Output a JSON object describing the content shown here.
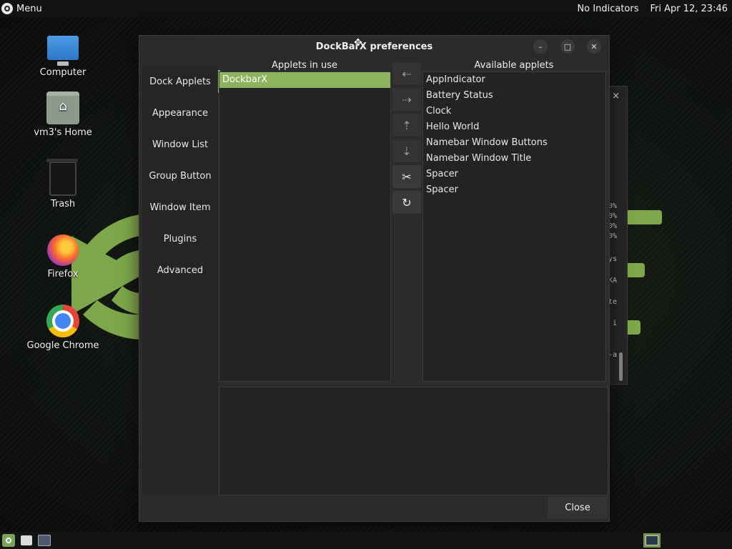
{
  "top_panel": {
    "menu_label": "Menu",
    "indicators": "No Indicators",
    "clock": "Fri Apr 12, 23:46"
  },
  "desktop_icons": [
    {
      "label": "Computer",
      "icon": "computer-icon"
    },
    {
      "label": "vm3's Home",
      "icon": "home-folder-icon"
    },
    {
      "label": "Trash",
      "icon": "trash-icon"
    },
    {
      "label": "Firefox",
      "icon": "firefox-icon"
    },
    {
      "label": "Google Chrome",
      "icon": "chrome-icon"
    }
  ],
  "dialog": {
    "title": "DockBarX preferences",
    "sidebar": [
      "Dock Applets",
      "Appearance",
      "Window List",
      "Group Button",
      "Window Item",
      "Plugins",
      "Advanced"
    ],
    "active_tab": "Dock Applets",
    "applets_in_use_header": "Applets in use",
    "applets_in_use": [
      "DockbarX"
    ],
    "available_header": "Available applets",
    "available_applets": [
      "AppIndicator",
      "Battery Status",
      "Clock",
      "Hello World",
      "Namebar Window Buttons",
      "Namebar Window Title",
      "Spacer",
      "Spacer"
    ],
    "tool_buttons": [
      "arrow-left-icon",
      "arrow-right-icon",
      "arrow-up-icon",
      "arrow-down-icon",
      "settings-tools-icon",
      "refresh-icon"
    ],
    "close_label": "Close"
  },
  "back_window": {
    "close_glyph": "×",
    "text_fragments": [
      "0%",
      "0%",
      "0%",
      "0%",
      "ys",
      "KA",
      "te",
      "i",
      "-a"
    ]
  },
  "colors": {
    "accent": "#8db45a",
    "dialog_bg": "#2b2b2b",
    "panel_bg": "#121212"
  }
}
